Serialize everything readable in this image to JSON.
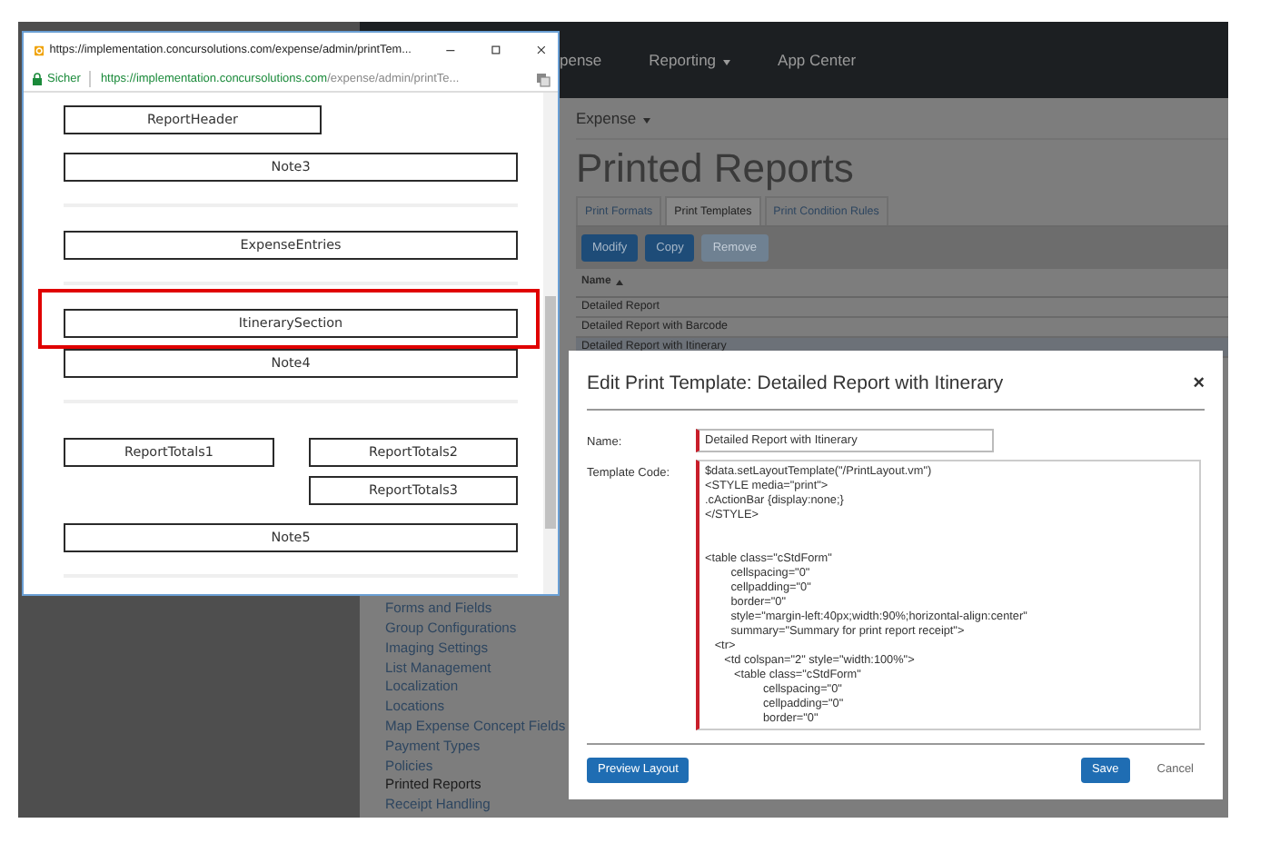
{
  "app": {
    "navbar": [
      {
        "label": "pense",
        "dropdown": false
      },
      {
        "label": "Reporting",
        "dropdown": true
      },
      {
        "label": "App Center",
        "dropdown": false
      }
    ],
    "subnav": {
      "label": "Expense",
      "dropdown": true
    },
    "sidebar": {
      "items": [
        {
          "label": "Forms and Fields",
          "selected": false
        },
        {
          "label": "Group Configurations",
          "selected": false
        },
        {
          "label": "Imaging Settings",
          "selected": false
        },
        {
          "label": "List Management",
          "selected": false
        },
        {
          "label": "Localization",
          "selected": false
        },
        {
          "label": "Locations",
          "selected": false
        },
        {
          "label": "Map Expense Concept Fields",
          "selected": false
        },
        {
          "label": "Payment Types",
          "selected": false
        },
        {
          "label": "Policies",
          "selected": false
        },
        {
          "label": "Printed Reports",
          "selected": true
        },
        {
          "label": "Receipt Handling",
          "selected": false
        }
      ]
    },
    "page_title": "Printed Reports",
    "tabs": [
      {
        "label": "Print Formats",
        "selected": false
      },
      {
        "label": "Print Templates",
        "selected": true
      },
      {
        "label": "Print Condition Rules",
        "selected": false
      }
    ],
    "toolbar": [
      {
        "label": "Modify",
        "disabled": false
      },
      {
        "label": "Copy",
        "disabled": false
      },
      {
        "label": "Remove",
        "disabled": true
      }
    ],
    "table": {
      "columns": [
        "Name"
      ],
      "rows": [
        {
          "name": "Detailed Report",
          "selected": false
        },
        {
          "name": "Detailed Report with Barcode",
          "selected": false
        },
        {
          "name": "Detailed Report with Itinerary",
          "selected": true
        }
      ]
    }
  },
  "popup": {
    "title": "https://implementation.concursolutions.com/expense/admin/printTem...",
    "security": "Sicher",
    "url_host": "https://implementation.concursolutions.com",
    "url_path": "/expense/admin/printTe...",
    "sections": [
      {
        "kind": "short",
        "label": "ReportHeader",
        "highlighted": false
      },
      {
        "kind": "full",
        "label": "Note3",
        "highlighted": false
      },
      {
        "kind": "divider"
      },
      {
        "kind": "full",
        "label": "ExpenseEntries",
        "highlighted": false
      },
      {
        "kind": "divider"
      },
      {
        "kind": "full",
        "label": "ItinerarySection",
        "highlighted": true
      },
      {
        "kind": "full",
        "label": "Note4",
        "highlighted": false
      },
      {
        "kind": "divider"
      },
      {
        "kind": "totals",
        "left": "ReportTotals1",
        "right": [
          "ReportTotals2",
          "ReportTotals3"
        ]
      },
      {
        "kind": "full",
        "label": "Note5",
        "highlighted": false
      },
      {
        "kind": "divider"
      }
    ]
  },
  "modal": {
    "title": "Edit Print Template: Detailed Report with Itinerary",
    "close": "×",
    "name_label": "Name:",
    "name_value": "Detailed Report with Itinerary",
    "code_label": "Template Code:",
    "code": "$data.setLayoutTemplate(\"/PrintLayout.vm\")\n<STYLE media=\"print\">\n.cActionBar {display:none;}\n</STYLE>\n\n\n<table class=\"cStdForm\"\n        cellspacing=\"0\"\n        cellpadding=\"0\"\n        border=\"0\"\n        style=\"margin-left:40px;width:90%;horizontal-align:center\"\n        summary=\"Summary for print report receipt\">\n   <tr>\n      <td colspan=\"2\" style=\"width:100%\">\n         <table class=\"cStdForm\"\n                  cellspacing=\"0\"\n                  cellpadding=\"0\"\n                  border=\"0\"",
    "buttons": [
      {
        "label": "Preview Layout",
        "kind": "primary"
      },
      {
        "label": "Save",
        "kind": "primary"
      },
      {
        "label": "Cancel",
        "kind": "plain"
      }
    ]
  }
}
